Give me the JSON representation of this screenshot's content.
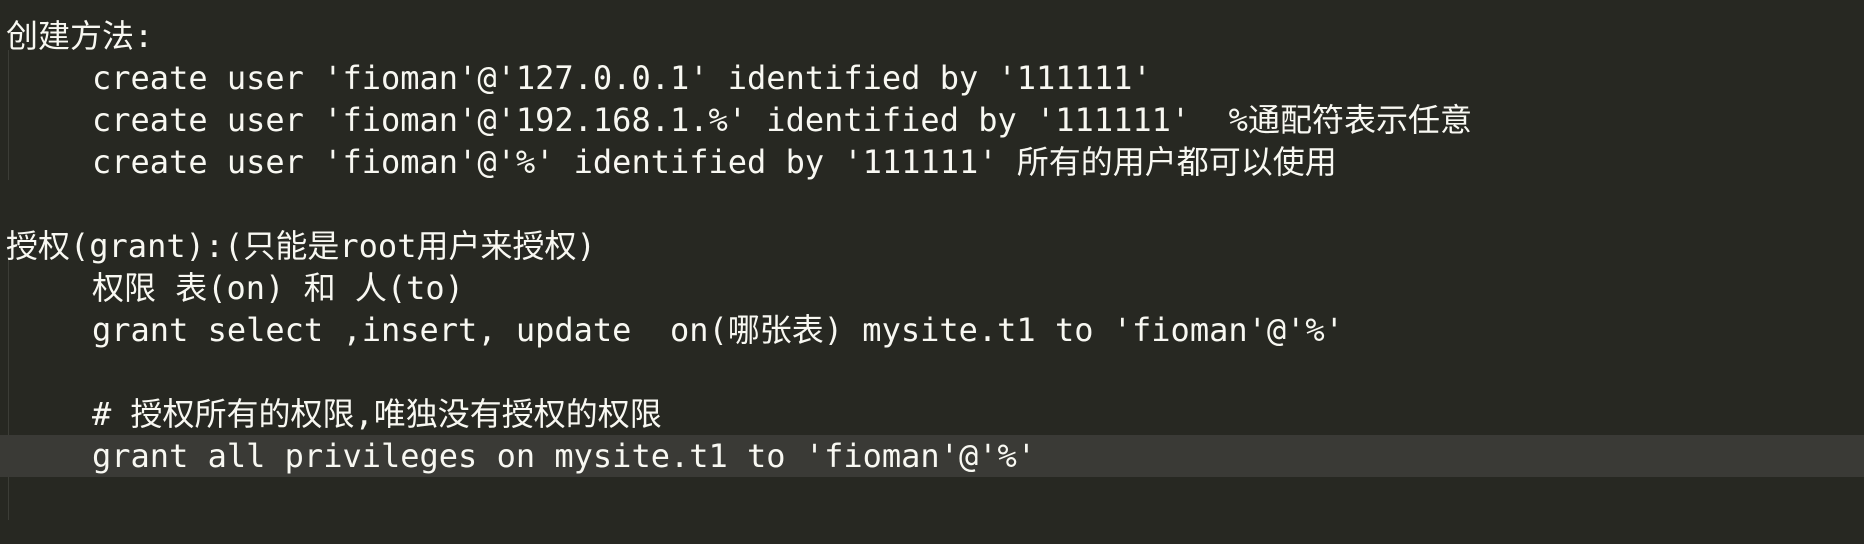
{
  "editor": {
    "theme_background": "#272822",
    "theme_foreground": "#f8f8f2",
    "current_line_background": "#3a3a36",
    "lines": [
      "创建方法:",
      "create user 'fioman'@'127.0.0.1' identified by '111111'",
      "create user 'fioman'@'192.168.1.%' identified by '111111'  %通配符表示任意",
      "create user 'fioman'@'%' identified by '111111' 所有的用户都可以使用",
      "",
      "授权(grant):(只能是root用户来授权)",
      "权限 表(on) 和 人(to)",
      "grant select ,insert, update  on(哪张表) mysite.t1 to 'fioman'@'%'",
      "",
      "# 授权所有的权限,唯独没有授权的权限",
      "grant all privileges on mysite.t1 to 'fioman'@'%'"
    ]
  }
}
